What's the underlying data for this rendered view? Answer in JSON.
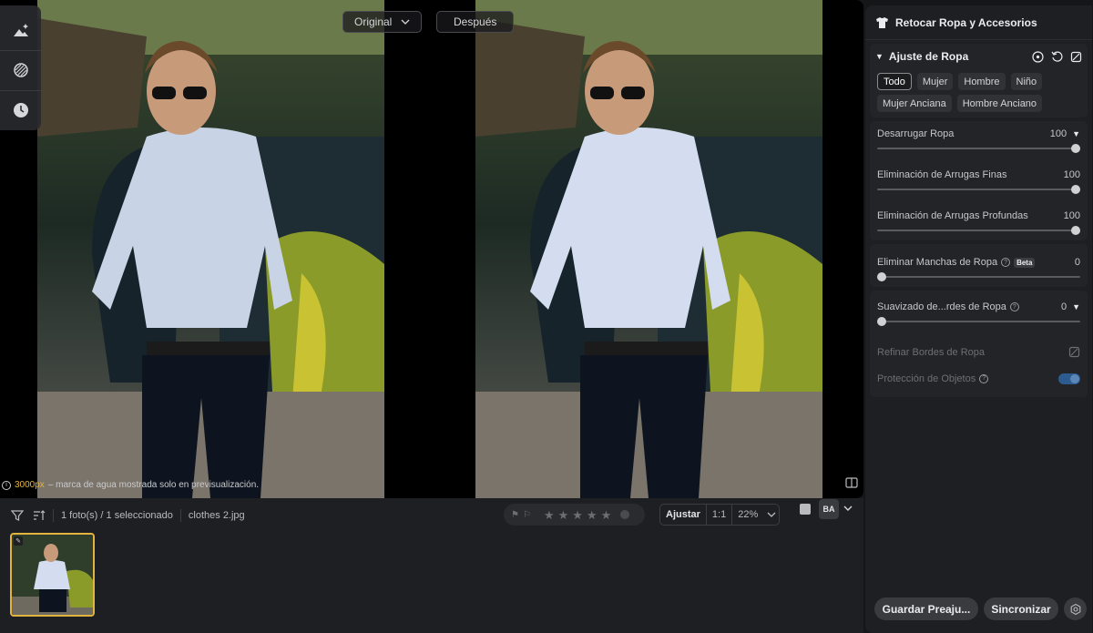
{
  "viewer": {
    "original_label": "Original",
    "after_label": "Después",
    "watermark_px": "3000px",
    "watermark_text": "– marca de agua mostrada solo en previsualización."
  },
  "left_tools": [
    "landscape-sparkle-icon",
    "texture-icon",
    "history-icon"
  ],
  "toolbar": {
    "photo_count": "1 foto(s) / 1 seleccionado",
    "filename": "clothes 2.jpg",
    "stars": [
      "★",
      "★",
      "★",
      "★",
      "★"
    ],
    "fit_label": "Ajustar",
    "one_to_one": "1:1",
    "zoom": "22%",
    "ba_label": "BA"
  },
  "panel": {
    "title": "Retocar Ropa y Accesorios",
    "section_title": "Ajuste de Ropa",
    "chips": [
      "Todo",
      "Mujer",
      "Hombre",
      "Niño",
      "Mujer Anciana",
      "Hombre Anciano"
    ],
    "sliders_group1": [
      {
        "label": "Desarrugar Ropa",
        "value": "100",
        "frac": 1.0,
        "caret": true
      },
      {
        "label": "Eliminación de Arrugas Finas",
        "value": "100",
        "frac": 1.0,
        "caret": false
      },
      {
        "label": "Eliminación de Arrugas Profundas",
        "value": "100",
        "frac": 1.0,
        "caret": false
      }
    ],
    "stain": {
      "label": "Eliminar Manchas de Ropa",
      "badge": "Beta",
      "value": "0",
      "frac": 0.0
    },
    "smooth": {
      "label": "Suavizado de...rdes de Ropa",
      "value": "0",
      "frac": 0.0
    },
    "refine_label": "Refinar Bordes de Ropa",
    "protect_label": "Protección de Objetos",
    "save_button": "Guardar Preaju...",
    "sync_button": "Sincronizar"
  }
}
